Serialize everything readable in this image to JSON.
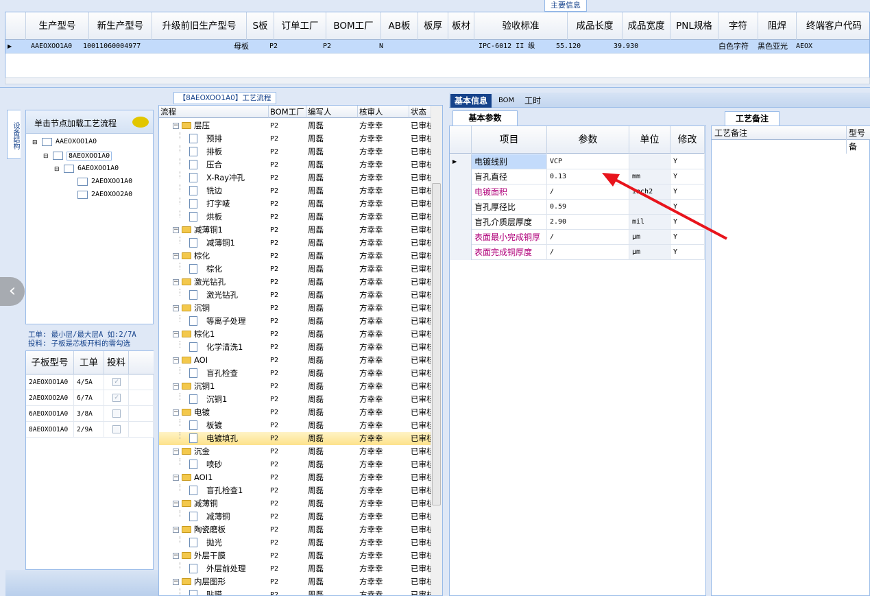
{
  "top": {
    "main_info_label": "主要信息",
    "columns": [
      "生产型号",
      "新生产型号",
      "升级前旧生产型号",
      "S板",
      "订单工厂",
      "BOM工厂",
      "AB板",
      "板厚",
      "板材",
      "验收标准",
      "成品长度",
      "成品宽度",
      "PNL规格",
      "字符",
      "阻焊",
      "终端客户代码"
    ],
    "row": {
      "prod_model": "AAEOXOO1A0",
      "new_model": "10011060004977",
      "s_board": "母板",
      "order_factory": "P2",
      "bom_factory": "P2",
      "ab_board": "N",
      "standard": "IPC-6012 II 级",
      "length": "55.120",
      "width": "39.930",
      "character": "白色字符",
      "solder": "黑色亚光",
      "customer": "AEOX"
    }
  },
  "left": {
    "vertical_tab": "设备结构",
    "load_label": "单击节点加载工艺流程",
    "tree": [
      "AAEOXOO1A0",
      "8AEOXOO1A0",
      "6AEOXOO1A0",
      "2AEOXOO1A0",
      "2AEOXOO2A0"
    ],
    "info_line1": "工单: 最小层/最大层A 如:2/7A",
    "info_line2": "投料: 子板是芯板开料的需勾选",
    "sub_headers": [
      "子板型号",
      "工单",
      "投料"
    ],
    "sub_rows": [
      {
        "model": "2AEOXOO1A0",
        "order": "4/5A",
        "checked": true
      },
      {
        "model": "2AEOXOO2A0",
        "order": "6/7A",
        "checked": true
      },
      {
        "model": "6AEOXOO1A0",
        "order": "3/8A",
        "checked": false
      },
      {
        "model": "8AEOXOO1A0",
        "order": "2/9A",
        "checked": false
      }
    ]
  },
  "process": {
    "title": "【8AEOXOO1A0】工艺流程",
    "headers": [
      "流程",
      "BOM工厂",
      "编写人",
      "核审人",
      "状态"
    ],
    "factory": "P2",
    "writer": "周磊",
    "reviewer": "方幸幸",
    "status": "已审核",
    "rows": [
      {
        "name": "层压",
        "level": 0
      },
      {
        "name": "预排",
        "level": 1
      },
      {
        "name": "排板",
        "level": 1
      },
      {
        "name": "压合",
        "level": 1
      },
      {
        "name": "X-Ray冲孔",
        "level": 1
      },
      {
        "name": "铣边",
        "level": 1
      },
      {
        "name": "打字唛",
        "level": 1
      },
      {
        "name": "烘板",
        "level": 1
      },
      {
        "name": "减薄铜1",
        "level": 0
      },
      {
        "name": "减薄铜1",
        "level": 1
      },
      {
        "name": "棕化",
        "level": 0
      },
      {
        "name": "棕化",
        "level": 1
      },
      {
        "name": "激光钻孔",
        "level": 0
      },
      {
        "name": "激光钻孔",
        "level": 1
      },
      {
        "name": "沉铜",
        "level": 0
      },
      {
        "name": "等离子处理",
        "level": 1
      },
      {
        "name": "棕化1",
        "level": 0
      },
      {
        "name": "化学清洗1",
        "level": 1
      },
      {
        "name": "AOI",
        "level": 0
      },
      {
        "name": "盲孔检查",
        "level": 1
      },
      {
        "name": "沉铜1",
        "level": 0
      },
      {
        "name": "沉铜1",
        "level": 1
      },
      {
        "name": "电镀",
        "level": 0
      },
      {
        "name": "板镀",
        "level": 1
      },
      {
        "name": "电镀填孔",
        "level": 1
      },
      {
        "name": "沉金",
        "level": 0
      },
      {
        "name": "喷砂",
        "level": 1
      },
      {
        "name": "AOI1",
        "level": 0
      },
      {
        "name": "盲孔检查1",
        "level": 1
      },
      {
        "name": "减薄铜",
        "level": 0
      },
      {
        "name": "减薄铜",
        "level": 1
      },
      {
        "name": "陶瓷磨板",
        "level": 0
      },
      {
        "name": "抛光",
        "level": 1
      },
      {
        "name": "外层干膜",
        "level": 0
      },
      {
        "name": "外层前处理",
        "level": 1
      },
      {
        "name": "内层图形",
        "level": 0
      },
      {
        "name": "贴膜",
        "level": 1
      }
    ],
    "selected_index": 24
  },
  "right": {
    "tabs": [
      "基本信息",
      "BOM",
      "工时"
    ],
    "basic_tab": "基本参数",
    "headers": [
      "项目",
      "参数",
      "单位",
      "修改"
    ],
    "rows": [
      {
        "item": "电镀线别",
        "param": "VCP",
        "unit": "",
        "edit": "Y",
        "color": "#000000"
      },
      {
        "item": "盲孔直径",
        "param": "0.13",
        "unit": "mm",
        "edit": "Y",
        "color": "#000000"
      },
      {
        "item": "电镀面积",
        "param": "/",
        "unit": "inch2",
        "edit": "Y",
        "color": "#b0007a"
      },
      {
        "item": "盲孔厚径比",
        "param": "0.59",
        "unit": "",
        "edit": "Y",
        "color": "#000000"
      },
      {
        "item": "盲孔介质层厚度",
        "param": "2.90",
        "unit": "mil",
        "edit": "Y",
        "color": "#000000"
      },
      {
        "item": "表面最小完成铜厚",
        "param": "/",
        "unit": "μm",
        "edit": "Y",
        "color": "#b0007a"
      },
      {
        "item": "表面完成铜厚度",
        "param": "/",
        "unit": "μm",
        "edit": "Y",
        "color": "#b0007a"
      }
    ],
    "remark_tab": "工艺备注",
    "remark_header": "工艺备注",
    "remark_col2": "型号备"
  },
  "colors": {
    "annotation_arrow": "#e8141c",
    "selected_row": "#c3dbfb",
    "header_blue": "#15428b"
  }
}
